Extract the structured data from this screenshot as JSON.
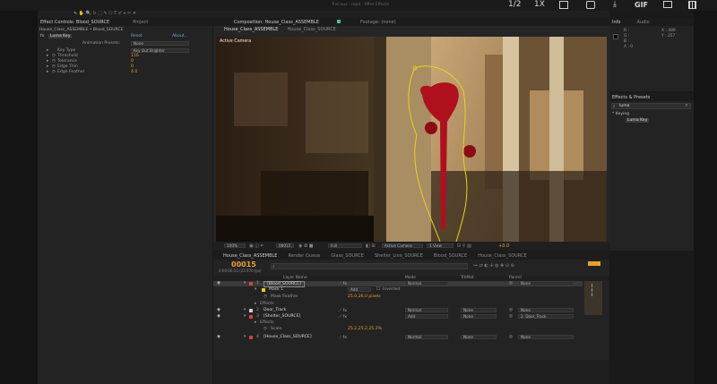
{
  "topbar": {
    "title": "Trai aux - mp4 - After Effects",
    "player": {
      "page": "1/2",
      "speed": "1X",
      "gif": "GIF"
    }
  },
  "effect_controls": {
    "tab": "Effect Controls: Blood_SOURCE",
    "tab2": "Project",
    "breadcrumb": "House_Class_ASSEMBLE • Blood_SOURCE",
    "effect_name": "Luma Key",
    "reset": "Reset",
    "about": "About...",
    "presets_label": "Animation Presets:",
    "presets_value": "None",
    "rows": [
      {
        "label": "Key Type",
        "value": "Key Out Brighter"
      },
      {
        "label": "Threshold",
        "value": "116"
      },
      {
        "label": "Tolerance",
        "value": "0"
      },
      {
        "label": "Edge Thin",
        "value": "0"
      },
      {
        "label": "Edge Feather",
        "value": "4.0"
      }
    ]
  },
  "composition": {
    "tab": "Composition: House_Class_ASSEMBLE",
    "tab2": "Footage: (none)",
    "subtabs": [
      "House_Class_ASSEMBLE",
      "House_Class_SOURCE"
    ],
    "camera": "Active Camera",
    "footer": {
      "zoom": "100%",
      "time": "00015",
      "res": "Full",
      "camera": "Active Camera",
      "view": "1 View",
      "exposure": "+0.0"
    }
  },
  "info": {
    "tab": "Info",
    "tab2": "Audio",
    "r": "R :",
    "g": "G :",
    "b": "B :",
    "a": "A : 0",
    "x": "X : 489",
    "y": "Y : 257"
  },
  "effects_presets": {
    "tab": "Effects & Presets",
    "search": "luma",
    "category": "* Keying",
    "item": "Luma Key"
  },
  "timeline": {
    "tabs": [
      "House_Class_ASSEMBLE",
      "Render Queue",
      "Glass_SOURCE",
      "Shelter_Line_SOURCE",
      "Blood_SOURCE",
      "House_Class_SOURCE"
    ],
    "timecode": "00015",
    "fps": "0:00:00:15 (23.976 fps)",
    "headers": {
      "name": "Layer Name",
      "mode": "Mode",
      "trkmat": "TrkMat",
      "parent": "Parent"
    },
    "layers": [
      {
        "num": "1",
        "name": "[Blood_SOURCE]",
        "mode": "Normal",
        "trkmat": "",
        "parent": "None",
        "color": "#c9453c",
        "selected": true
      },
      {
        "num": "2",
        "name": "Door_Track",
        "mode": "Normal",
        "trkmat": "None",
        "parent": "None",
        "color": "#cfcfcf",
        "selected": false
      },
      {
        "num": "3",
        "name": "[Shelter_SOURCE]",
        "mode": "Add",
        "trkmat": "None",
        "parent": "2. Door_Track",
        "color": "#c9453c",
        "selected": false
      },
      {
        "num": "4",
        "name": "[House_Class_SOURCE]",
        "mode": "Normal",
        "trkmat": "None",
        "parent": "None",
        "color": "#c9453c",
        "selected": false
      }
    ],
    "mask": {
      "name": "Mask 1",
      "mode": "Add",
      "inverted": "Inverted",
      "feather_label": "Mask Feather",
      "feather_value": "25.0,26.0 pixels"
    },
    "effects_label": "Effects",
    "scale_label": "Scale",
    "scale_value": "25.2,25.2,25.2%"
  }
}
